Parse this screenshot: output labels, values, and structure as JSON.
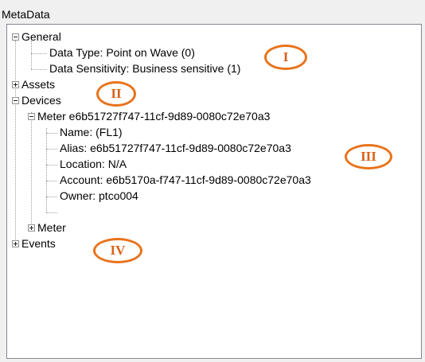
{
  "panel": {
    "title": "MetaData"
  },
  "tree": {
    "general": "General",
    "data_type": "Data Type: Point on Wave (0)",
    "data_sensitivity": "Data Sensitivity: Business sensitive (1)",
    "assets": "Assets",
    "devices": "Devices",
    "meter1": "Meter e6b51727f747-11cf-9d89-0080c72e70a3",
    "meter1_name": "Name: (FL1)",
    "meter1_alias": "Alias: e6b51727f747-11cf-9d89-0080c72e70a3",
    "meter1_location": "Location: N/A",
    "meter1_account": "Account: e6b5170a-f747-11cf-9d89-0080c72e70a3",
    "meter1_owner": "Owner: ptco004",
    "meter2": "Meter",
    "events": "Events"
  },
  "annotations": {
    "marker_1": "I",
    "marker_2": "II",
    "marker_3": "III",
    "marker_4": "IV"
  },
  "colors": {
    "marker": "#e8731c",
    "border": "#828790",
    "tree_lines": "#a0a0a0"
  }
}
